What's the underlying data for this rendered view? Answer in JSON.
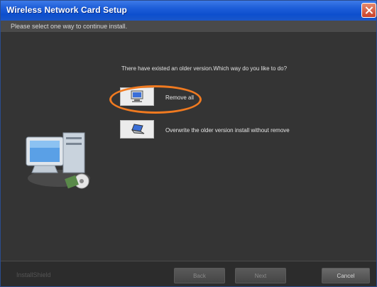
{
  "window": {
    "title": "Wireless Network Card Setup",
    "subtitle": "Please select one way to continue install."
  },
  "main": {
    "prompt": "There have existed an older version.Which way do you like to do?",
    "options": [
      {
        "label": "Remove all",
        "icon": "computer-icon"
      },
      {
        "label": "Overwrite the older version install without remove",
        "icon": "laptop-icon"
      }
    ]
  },
  "footer": {
    "brand": "InstallShield",
    "buttons": {
      "back": "Back",
      "next": "Next",
      "cancel": "Cancel"
    }
  },
  "colors": {
    "title_bar": "#0d4fce",
    "highlight": "#f07a20",
    "background": "#343434"
  }
}
